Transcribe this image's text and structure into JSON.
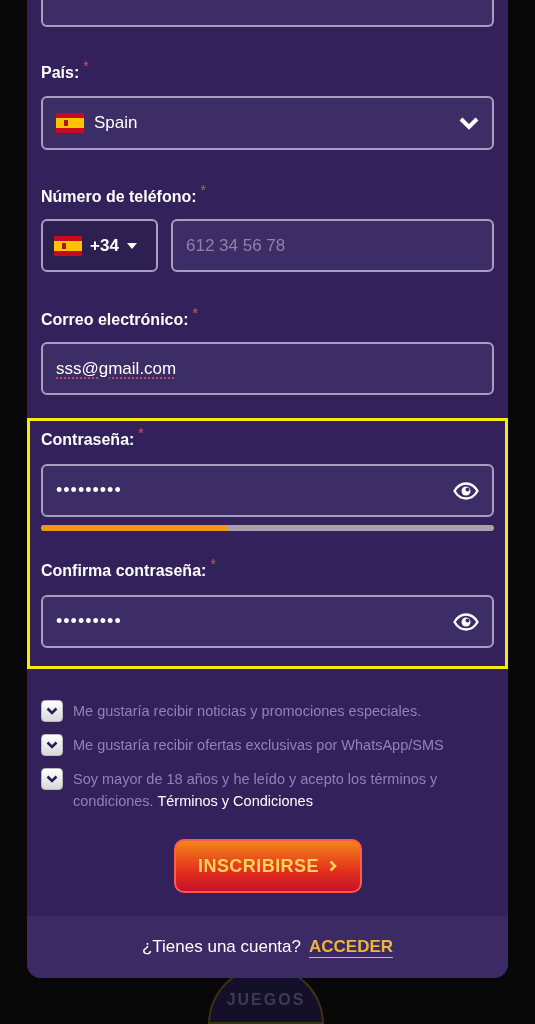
{
  "fields": [
    {
      "kind": "select",
      "label": "País:",
      "required_mark": "*",
      "value": "Spain"
    },
    {
      "kind": "phone",
      "label": "Número de teléfono:",
      "required_mark": "*",
      "dial_code": "+34",
      "placeholder": "612 34 56 78"
    },
    {
      "kind": "text",
      "label": "Correo electrónico:",
      "required_mark": "*",
      "value": "sss@gmail.com"
    }
  ],
  "password_section": {
    "highlighted": true,
    "fields": [
      {
        "kind": "password",
        "label": "Contraseña:",
        "required_mark": "*",
        "value": "•••••••••",
        "strength": {
          "level": 0.41
        }
      },
      {
        "kind": "password",
        "label": "Confirma contraseña:",
        "required_mark": "*",
        "value": "•••••••••"
      }
    ]
  },
  "consents": [
    {
      "text": "Me gustaría recibir noticias y promociones especiales.",
      "checked": true
    },
    {
      "text": "Me gustaría recibir ofertas exclusivas por WhatsApp/SMS",
      "checked": true
    },
    {
      "text": "Soy mayor de 18 años y he leído y acepto los términos y condiciones.",
      "link": "Términos y Condiciones",
      "checked": true
    }
  ],
  "submit_button": {
    "label": "INSCRIBIRSE"
  },
  "footer": {
    "question": "¿Tienes una cuenta?",
    "link": "ACCEDER"
  },
  "background_nav": {
    "label": "JUEGOS"
  }
}
